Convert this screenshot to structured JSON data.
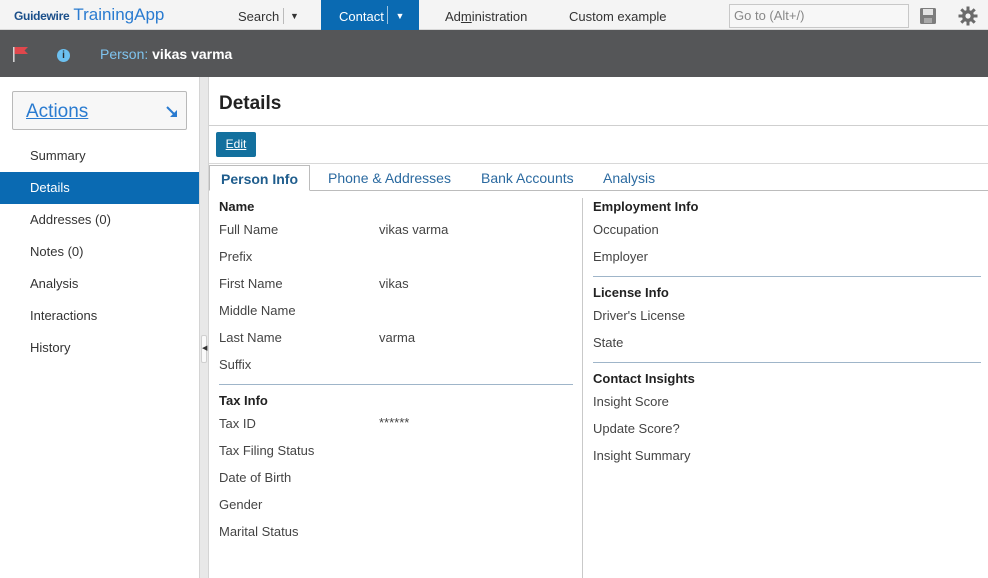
{
  "topbar": {
    "brand": "Guidewire",
    "app_name": "TrainingApp",
    "nav_search": "Search",
    "nav_contact": "Contact",
    "nav_admin_pre": "Ad",
    "nav_admin_key": "m",
    "nav_admin_post": "inistration",
    "nav_custom": "Custom example",
    "goto_placeholder": "Go to (Alt+/)"
  },
  "infobar": {
    "person_prefix": "Person:",
    "person_name": "vikas varma"
  },
  "sidebar": {
    "actions_label": "Actions",
    "items": [
      {
        "label": "Summary"
      },
      {
        "label": "Details"
      },
      {
        "label": "Addresses (0)"
      },
      {
        "label": "Notes (0)"
      },
      {
        "label": "Analysis"
      },
      {
        "label": "Interactions"
      },
      {
        "label": "History"
      }
    ]
  },
  "main": {
    "title": "Details",
    "edit_label": "Edit",
    "tabs": [
      {
        "label": "Person Info"
      },
      {
        "label": "Phone & Addresses"
      },
      {
        "label": "Bank Accounts"
      },
      {
        "label": "Analysis"
      }
    ],
    "left": {
      "name_section": "Name",
      "full_name_label": "Full Name",
      "full_name_value": "vikas varma",
      "prefix_label": "Prefix",
      "first_name_label": "First Name",
      "first_name_value": "vikas",
      "middle_name_label": "Middle Name",
      "last_name_label": "Last Name",
      "last_name_value": "varma",
      "suffix_label": "Suffix",
      "tax_section": "Tax Info",
      "tax_id_label": "Tax ID",
      "tax_id_value": "******",
      "tax_filing_label": "Tax Filing Status",
      "dob_label": "Date of Birth",
      "gender_label": "Gender",
      "marital_label": "Marital Status"
    },
    "right": {
      "employment_section": "Employment Info",
      "occupation_label": "Occupation",
      "employer_label": "Employer",
      "license_section": "License Info",
      "drivers_license_label": "Driver's License",
      "state_label": "State",
      "insights_section": "Contact Insights",
      "insight_score_label": "Insight Score",
      "update_score_label": "Update Score?",
      "insight_summary_label": "Insight Summary"
    }
  },
  "colors": {
    "accent": "#0a6ab2",
    "header_bg": "#555658",
    "link": "#2a7bd0",
    "flag": "#e0474c"
  }
}
